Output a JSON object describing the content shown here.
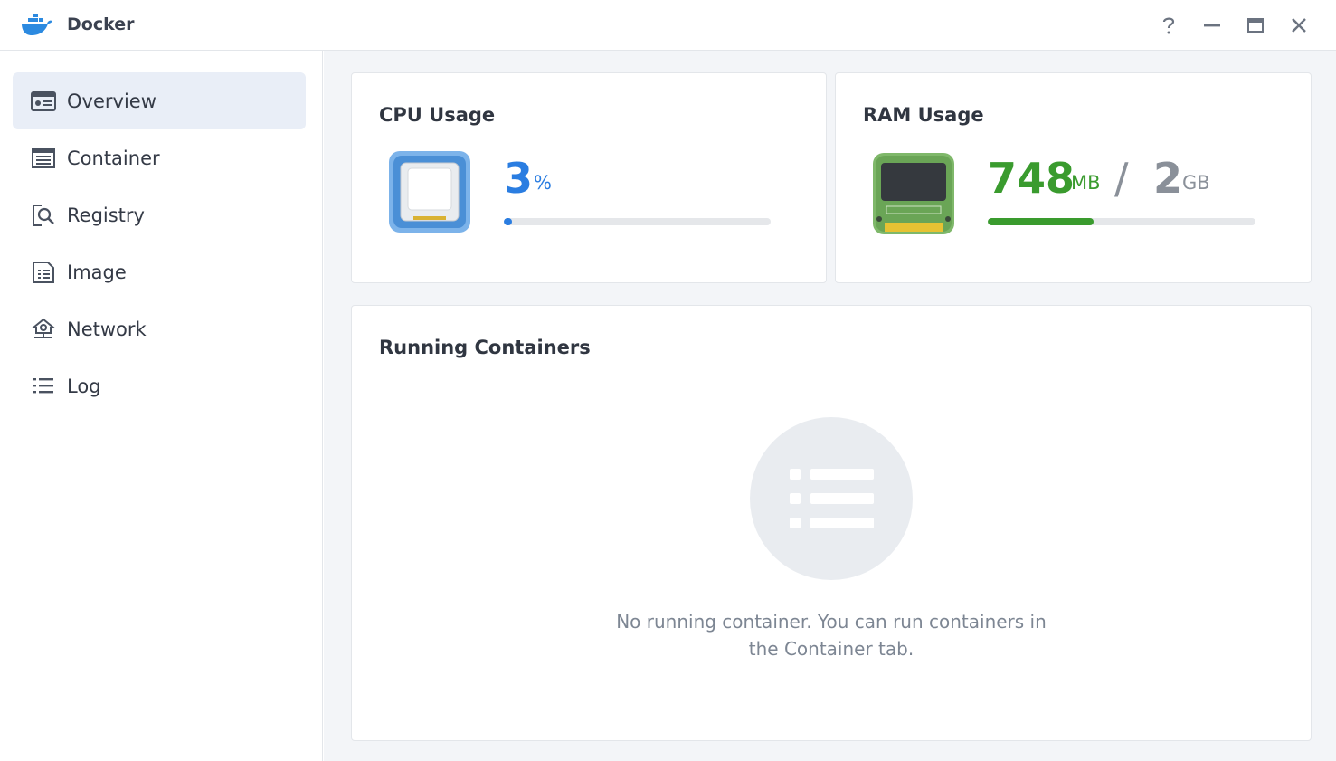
{
  "app": {
    "title": "Docker"
  },
  "window_controls": [
    {
      "name": "help-button",
      "icon": "question-icon"
    },
    {
      "name": "minimize-button",
      "icon": "minimize-icon"
    },
    {
      "name": "maximize-button",
      "icon": "maximize-icon"
    },
    {
      "name": "close-button",
      "icon": "close-icon"
    }
  ],
  "sidebar": {
    "items": [
      {
        "label": "Overview",
        "icon": "overview-icon",
        "active": true
      },
      {
        "label": "Container",
        "icon": "container-icon",
        "active": false
      },
      {
        "label": "Registry",
        "icon": "registry-icon",
        "active": false
      },
      {
        "label": "Image",
        "icon": "image-icon",
        "active": false
      },
      {
        "label": "Network",
        "icon": "network-icon",
        "active": false
      },
      {
        "label": "Log",
        "icon": "log-icon",
        "active": false
      }
    ]
  },
  "cpu": {
    "title": "CPU Usage",
    "value": "3",
    "unit": "%",
    "percent": 3,
    "color": "#2a7de1"
  },
  "ram": {
    "title": "RAM Usage",
    "used": "748",
    "used_unit": "MB",
    "separator": "/",
    "total": "2",
    "total_unit": "GB",
    "percent": 39.5,
    "used_color": "#3a9b2e",
    "total_color": "#8a9099"
  },
  "running": {
    "title": "Running Containers",
    "empty_line1": "No running container. You can run containers in",
    "empty_line2": "the Container tab."
  }
}
